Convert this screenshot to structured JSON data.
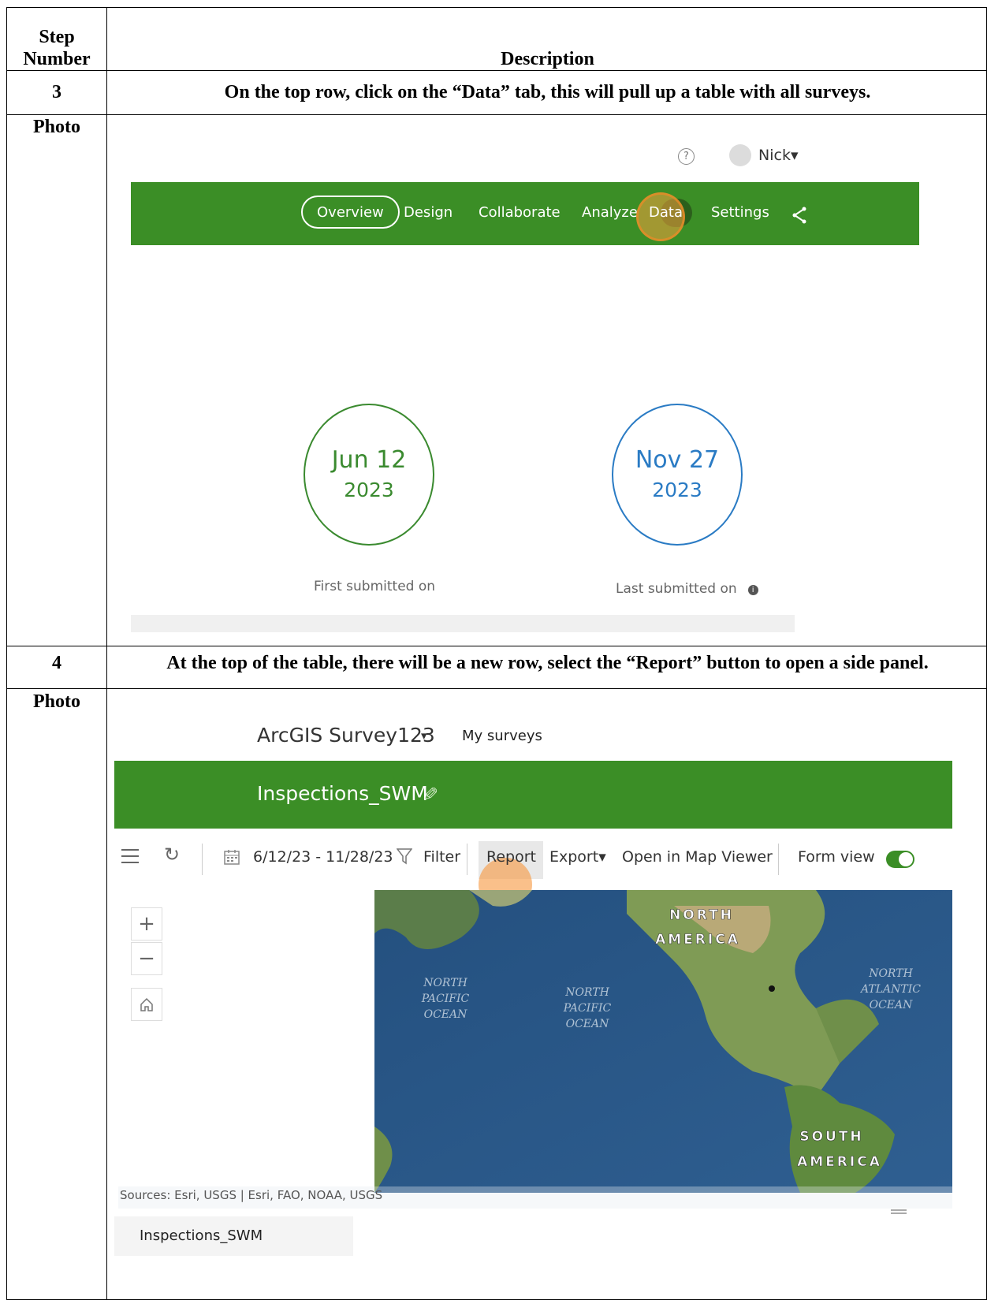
{
  "table": {
    "header": {
      "step_line1": "Step",
      "step_line2": "Number",
      "description": "Description"
    },
    "rows": [
      {
        "step": "3",
        "description": "On the top row, click on the “Data” tab, this will pull up a table with all surveys.",
        "photo_label": "Photo"
      },
      {
        "step": "4",
        "description": "At the top of the table, there will be a new row, select the “Report” button to open a side panel.",
        "photo_label": "Photo"
      }
    ]
  },
  "screenshot1": {
    "help_icon": "?",
    "user_name": "Nick▾",
    "tabs": [
      "Overview",
      "Design",
      "Collaborate",
      "Analyze",
      "Data",
      "Settings"
    ],
    "active_tab": "Overview",
    "highlighted_tab": "Data",
    "share_icon": "share-icon",
    "first": {
      "month_day": "Jun 12",
      "year": "2023",
      "caption": "First submitted on",
      "color": "#3a8a2f"
    },
    "last": {
      "month_day": "Nov 27",
      "year": "2023",
      "caption": "Last submitted on",
      "color": "#2a7bc4"
    }
  },
  "screenshot2": {
    "app_title": "ArcGIS Survey123",
    "app_caret": "▾",
    "my_surveys": "My surveys",
    "survey_name": "Inspections_SWM",
    "date_range": "6/12/23 - 11/28/23",
    "filter": "Filter",
    "report": "Report",
    "export": "Export▾",
    "open_map": "Open in Map Viewer",
    "form_view": "Form view",
    "zoom_in": "+",
    "zoom_out": "−",
    "map_labels": {
      "north_america_1": "NORTH",
      "north_america_2": "AMERICA",
      "npo_left_1": "NORTH",
      "npo_left_2": "PACIFIC",
      "npo_left_3": "OCEAN",
      "npo_mid_1": "NORTH",
      "npo_mid_2": "PACIFIC",
      "npo_mid_3": "OCEAN",
      "nao_1": "NORTH",
      "nao_2": "ATLANTIC",
      "nao_3": "OCEAN",
      "sa_1": "SOUTH",
      "sa_2": "AMERICA"
    },
    "sources": "Sources: Esri, USGS | Esri, FAO, NOAA, USGS",
    "layer_tab": "Inspections_SWM"
  },
  "colors": {
    "brand_green": "#3b8e26",
    "highlight_orange": "#f7a03c"
  }
}
